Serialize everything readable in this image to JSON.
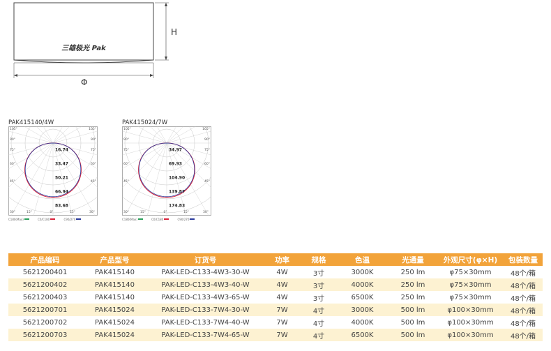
{
  "product_drawing": {
    "brand_logo": "三雄极光 Pak",
    "height_label": "H",
    "diameter_label": "Φ"
  },
  "polar_charts": [
    {
      "title": "PAK415140/4W",
      "cd_values": [
        "16.74",
        "33.47",
        "50.21",
        "66.94",
        "83.68"
      ],
      "top_angles": [
        "105°",
        "90°",
        "75°",
        "60°",
        "45°"
      ],
      "bottom_angles": [
        "30°",
        "15°",
        "0°",
        "15°",
        "30°"
      ],
      "legend": [
        "C180(Max)",
        "C0/C180",
        "C90/270"
      ]
    },
    {
      "title": "PAK415024/7W",
      "cd_values": [
        "34.97",
        "69.93",
        "104.90",
        "139.87",
        "174.83"
      ],
      "top_angles": [
        "105°",
        "90°",
        "75°",
        "60°",
        "45°"
      ],
      "bottom_angles": [
        "30°",
        "15°",
        "0°",
        "15°",
        "30°"
      ],
      "legend": [
        "C180(Max)",
        "C0/C180",
        "C90/270"
      ]
    }
  ],
  "colors": {
    "header_bg": "#f2a33a",
    "alt_row_bg": "#fdf2d2",
    "curve_c0": "#d9233b",
    "curve_c90": "#2a3a9c",
    "curve_max": "#2aa05a"
  },
  "table": {
    "headers": [
      "产品编码",
      "产品型号",
      "订货号",
      "功率",
      "规格",
      "色温",
      "光通量",
      "外观尺寸(φ×H)",
      "包装数量"
    ],
    "rows": [
      [
        "5621200401",
        "PAK415140",
        "PAK-LED-C133-4W3-30-W",
        "4W",
        "3寸",
        "3000K",
        "250 lm",
        "φ75×30mm",
        "48个/箱"
      ],
      [
        "5621200402",
        "PAK415140",
        "PAK-LED-C133-4W3-40-W",
        "4W",
        "3寸",
        "4000K",
        "250 lm",
        "φ75×30mm",
        "48个/箱"
      ],
      [
        "5621200403",
        "PAK415140",
        "PAK-LED-C133-4W3-65-W",
        "4W",
        "3寸",
        "6500K",
        "250 lm",
        "φ75×30mm",
        "48个/箱"
      ],
      [
        "5621200701",
        "PAK415024",
        "PAK-LED-C133-7W4-30-W",
        "7W",
        "4寸",
        "3000K",
        "500 lm",
        "φ100×30mm",
        "48个/箱"
      ],
      [
        "5621200702",
        "PAK415024",
        "PAK-LED-C133-7W4-40-W",
        "7W",
        "4寸",
        "4000K",
        "500 lm",
        "φ100×30mm",
        "48个/箱"
      ],
      [
        "5621200703",
        "PAK415024",
        "PAK-LED-C133-7W4-65-W",
        "7W",
        "4寸",
        "6500K",
        "500 lm",
        "φ100×30mm",
        "48个/箱"
      ]
    ]
  }
}
